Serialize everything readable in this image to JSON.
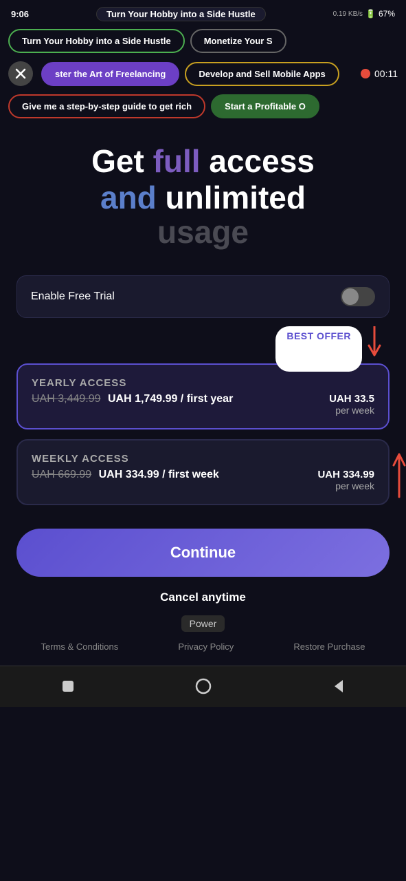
{
  "statusBar": {
    "time": "9:06",
    "centerLabel": "Turn Your Hobby into a Side Hustle",
    "rightLabel": "Monetize Your S",
    "battery": "67%",
    "network": "0.19 KB/s"
  },
  "pills": {
    "row1Left": "Turn Your Hobby into a Side Hustle",
    "row1Right": "Monetize Your S",
    "row2Left": "ster the Art of Freelancing",
    "row2Middle": "Develop and Sell Mobile Apps",
    "row3Left": "Give me a step-by-step guide to get rich",
    "row3Right": "Start a Profitable O"
  },
  "timer": {
    "time": "00:11"
  },
  "headline": {
    "line1a": "Get ",
    "line1b": "full",
    "line1c": " access",
    "line2a": "and",
    "line2b": " unlimited",
    "line3": "usage"
  },
  "toggle": {
    "label": "Enable Free Trial"
  },
  "bestOffer": {
    "label": "BEST OFFER"
  },
  "plans": [
    {
      "id": "yearly",
      "name": "YEARLY ACCESS",
      "priceStrike": "UAH 3,449.99",
      "price": "UAH 1,749.99 / first year",
      "sideMain": "UAH 33.5",
      "sideLabel": "per week",
      "selected": true
    },
    {
      "id": "weekly",
      "name": "WEEKLY ACCESS",
      "priceStrike": "UAH 669.99",
      "price": "UAH 334.99 / first week",
      "sideMain": "UAH 334.99",
      "sideLabel": "per week",
      "selected": false
    }
  ],
  "continueBtn": "Continue",
  "cancelText": "Cancel anytime",
  "powerBadge": "Power",
  "footerLinks": {
    "terms": "Terms & Conditions",
    "privacy": "Privacy Policy",
    "restore": "Restore Purchase"
  },
  "bottomNav": {
    "square": "■",
    "circle": "○",
    "triangle": "◀"
  }
}
